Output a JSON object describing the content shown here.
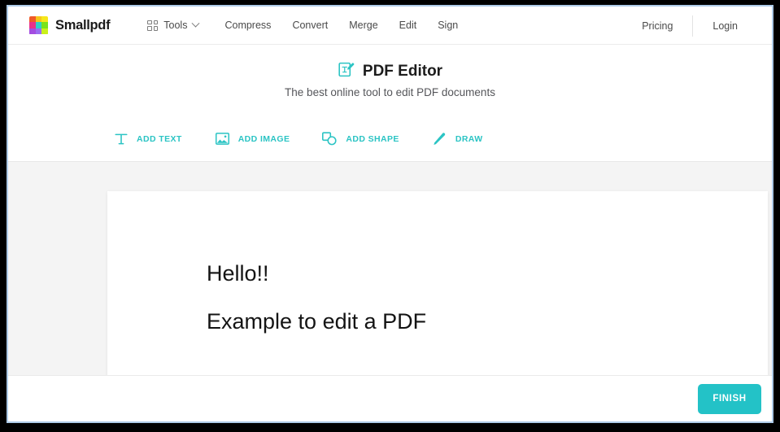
{
  "brand": {
    "name": "Smallpdf",
    "logo_icon": "smallpdf-color-grid-logo",
    "logo_colors": [
      "#f05a28",
      "#f6c51b",
      "#f6e71b",
      "#e8318a",
      "#2fd0c8",
      "#7ae31b",
      "#a34ce0",
      "#9b6cf0",
      "#c9f01b"
    ]
  },
  "nav": {
    "tools_label": "Tools",
    "tools_icon": "grid-icon",
    "chevron_icon": "chevron-down-icon",
    "links": [
      {
        "label": "Compress"
      },
      {
        "label": "Convert"
      },
      {
        "label": "Merge"
      },
      {
        "label": "Edit"
      },
      {
        "label": "Sign"
      }
    ],
    "pricing_label": "Pricing",
    "login_label": "Login"
  },
  "hero": {
    "icon": "pdf-editor-document-pencil-icon",
    "title": "PDF Editor",
    "subtitle": "The best online tool to edit PDF documents"
  },
  "toolbar": {
    "tools": [
      {
        "label": "ADD TEXT",
        "icon": "text-t-icon"
      },
      {
        "label": "ADD IMAGE",
        "icon": "image-icon"
      },
      {
        "label": "ADD SHAPE",
        "icon": "shape-square-circle-icon"
      },
      {
        "label": "DRAW",
        "icon": "pencil-icon"
      }
    ],
    "accent_color": "#2bc4c4"
  },
  "document": {
    "lines": [
      "Hello!!",
      "Example to edit a PDF"
    ]
  },
  "bottom_bar": {
    "finish_label": "FINISH",
    "finish_color": "#23c2c7"
  }
}
